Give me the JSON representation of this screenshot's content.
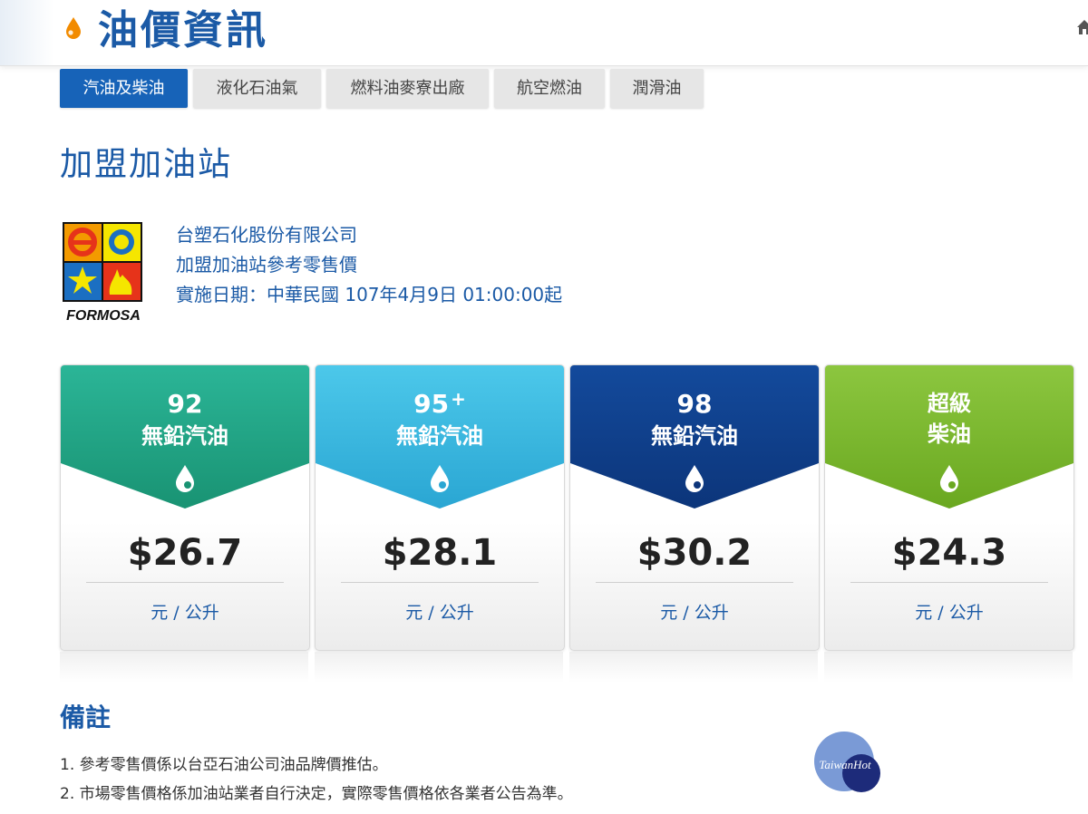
{
  "header": {
    "title": "油價資訊",
    "icons": {
      "title_icon": "fuel-drop-icon",
      "home_icon": "home-icon"
    },
    "accent_color": "#1b5aa6",
    "icon_color": "#f28b00"
  },
  "tabs": [
    {
      "label": "汽油及柴油",
      "active": true
    },
    {
      "label": "液化石油氣",
      "active": false
    },
    {
      "label": "燃料油麥寮出廠",
      "active": false
    },
    {
      "label": "航空燃油",
      "active": false
    },
    {
      "label": "潤滑油",
      "active": false
    }
  ],
  "section": {
    "title": "加盟加油站"
  },
  "company": {
    "logo_text": "FORMOSA",
    "name": "台塑石化股份有限公司",
    "subtitle": "加盟加油站參考零售價",
    "effective": "實施日期：中華民國 107年4月9日 01:00:00起"
  },
  "cards": [
    {
      "grade": "92",
      "grade_sup": "",
      "fuel": "無鉛汽油",
      "price": "$26.7",
      "unit": "元 / 公升",
      "color_top": "#2bb597",
      "color_bottom": "#199373"
    },
    {
      "grade": "95",
      "grade_sup": "+",
      "fuel": "無鉛汽油",
      "price": "$28.1",
      "unit": "元 / 公升",
      "color_top": "#4cc8ea",
      "color_bottom": "#2aa6d3"
    },
    {
      "grade": "98",
      "grade_sup": "",
      "fuel": "無鉛汽油",
      "price": "$30.2",
      "unit": "元 / 公升",
      "color_top": "#134a9c",
      "color_bottom": "#0c357a"
    },
    {
      "grade": "超級",
      "grade_sup": "",
      "fuel": "柴油",
      "price": "$24.3",
      "unit": "元 / 公升",
      "color_top": "#8cc63f",
      "color_bottom": "#6aa820"
    }
  ],
  "notes": {
    "title": "備註",
    "items": [
      "1. 參考零售價係以台亞石油公司油品牌價推估。",
      "2. 市場零售價格係加油站業者自行決定，實際零售價格依各業者公告為準。"
    ]
  },
  "watermark": {
    "text": "TaiwanHot"
  }
}
